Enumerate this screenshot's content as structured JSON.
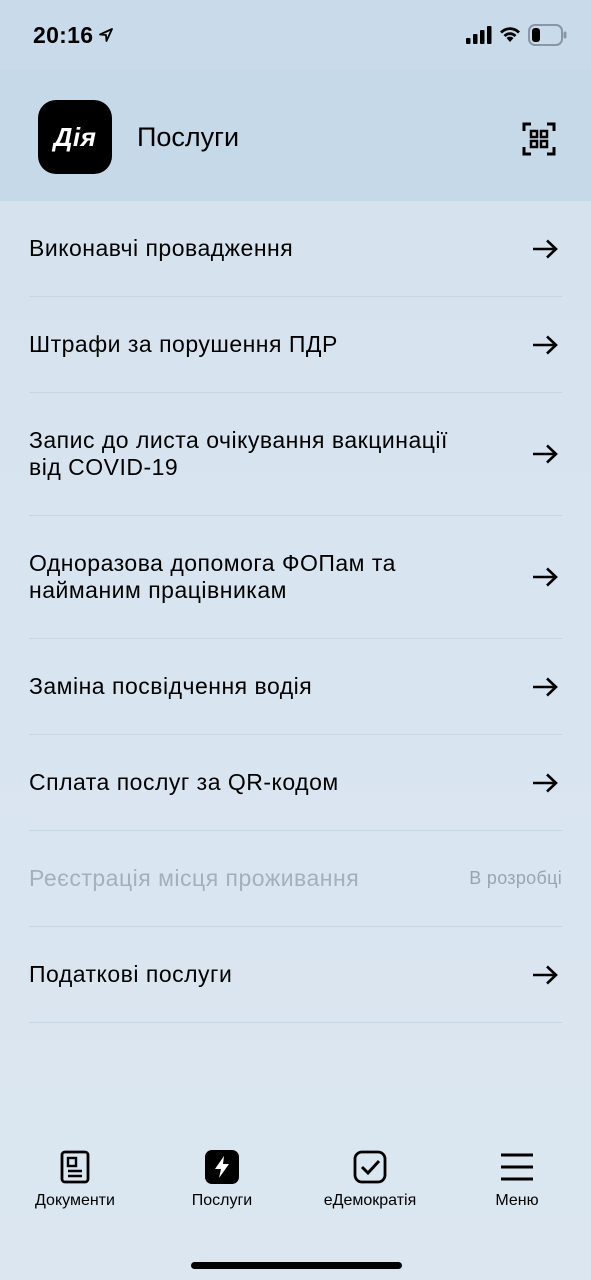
{
  "status_bar": {
    "time": "20:16"
  },
  "header": {
    "logo_text": "Дія",
    "title": "Послуги"
  },
  "services": [
    {
      "label": "Виконавчі провадження",
      "badge": ""
    },
    {
      "label": "Штрафи за порушення ПДР",
      "badge": ""
    },
    {
      "label": "Запис до листа очікування вакцинації від COVID-19",
      "badge": ""
    },
    {
      "label": "Одноразова допомога ФОПам та найманим працівникам",
      "badge": ""
    },
    {
      "label": "Заміна посвідчення водія",
      "badge": ""
    },
    {
      "label": "Сплата послуг за QR-кодом",
      "badge": ""
    },
    {
      "label": "Реєстрація місця проживання",
      "badge": "В розробці"
    },
    {
      "label": "Податкові послуги",
      "badge": ""
    }
  ],
  "tab_bar": {
    "tabs": [
      {
        "label": "Документи",
        "icon": "document-icon"
      },
      {
        "label": "Послуги",
        "icon": "lightning-icon"
      },
      {
        "label": "еДемократія",
        "icon": "checkbox-icon"
      },
      {
        "label": "Меню",
        "icon": "menu-icon"
      }
    ]
  }
}
